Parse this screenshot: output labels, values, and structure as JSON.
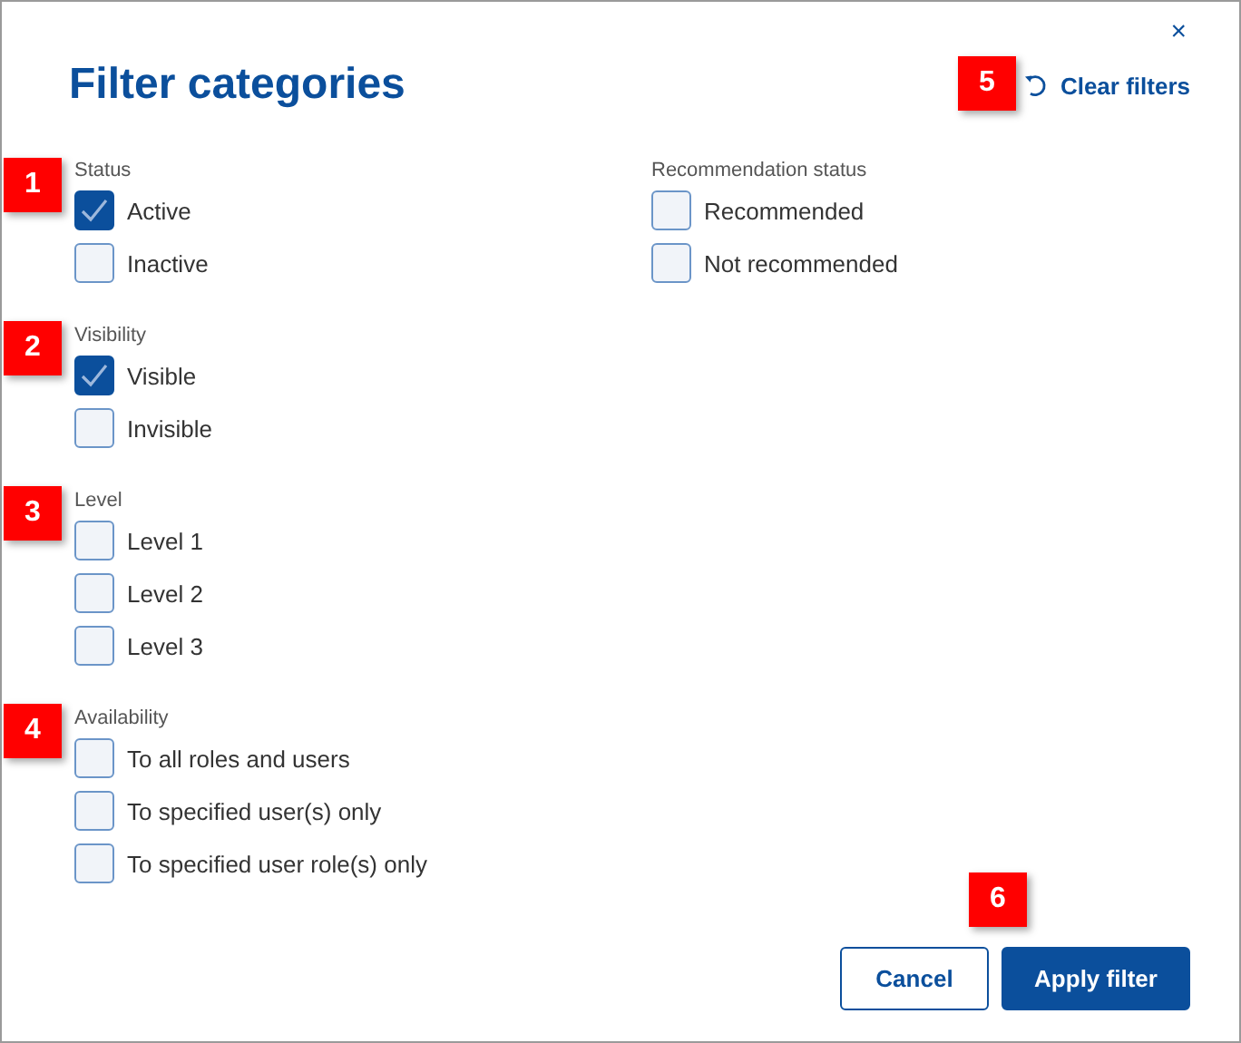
{
  "dialog": {
    "close": "×",
    "title": "Filter categories",
    "clear_filters": "Clear filters"
  },
  "columns": [
    {
      "groups": [
        {
          "label": "Status",
          "options": [
            {
              "label": "Active",
              "checked": true
            },
            {
              "label": "Inactive",
              "checked": false
            }
          ]
        },
        {
          "label": "Visibility",
          "options": [
            {
              "label": "Visible",
              "checked": true
            },
            {
              "label": "Invisible",
              "checked": false
            }
          ]
        },
        {
          "label": "Level",
          "options": [
            {
              "label": "Level 1",
              "checked": false
            },
            {
              "label": "Level 2",
              "checked": false
            },
            {
              "label": "Level 3",
              "checked": false
            }
          ]
        },
        {
          "label": "Availability",
          "options": [
            {
              "label": "To all roles and users",
              "checked": false
            },
            {
              "label": "To specified user(s) only",
              "checked": false
            },
            {
              "label": "To specified user role(s) only",
              "checked": false
            }
          ]
        }
      ]
    },
    {
      "groups": [
        {
          "label": "Recommendation status",
          "options": [
            {
              "label": "Recommended",
              "checked": false
            },
            {
              "label": "Not recommended",
              "checked": false
            }
          ]
        }
      ]
    }
  ],
  "buttons": [
    {
      "label": "Cancel",
      "kind": "secondary"
    },
    {
      "label": "Apply filter",
      "kind": "primary"
    }
  ],
  "callouts": [
    {
      "label": "1"
    },
    {
      "label": "2"
    },
    {
      "label": "3"
    },
    {
      "label": "4"
    },
    {
      "label": "5"
    },
    {
      "label": "6"
    }
  ]
}
